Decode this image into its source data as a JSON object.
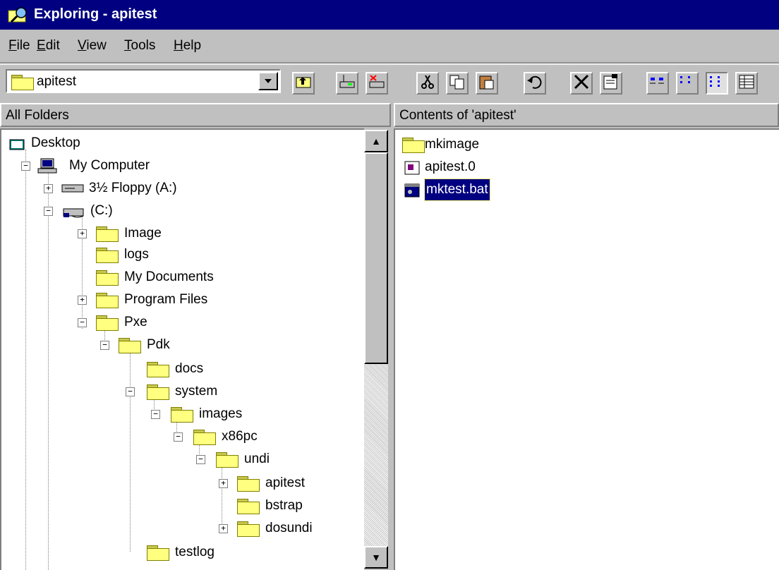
{
  "window": {
    "title": "Exploring - apitest"
  },
  "menu": [
    {
      "label": "File",
      "accel": "F",
      "rest": "ile"
    },
    {
      "label": "Edit",
      "accel": "E",
      "rest": "dit"
    },
    {
      "label": "View",
      "accel": "V",
      "rest": "iew"
    },
    {
      "label": "Tools",
      "accel": "T",
      "rest": "ools"
    },
    {
      "label": "Help",
      "accel": "H",
      "rest": "elp"
    }
  ],
  "toolbar": {
    "address_value": "apitest"
  },
  "left_header": "All Folders",
  "right_header": "Contents of 'apitest'",
  "tree": [
    {
      "label": "Desktop",
      "icon": "desktop-icon"
    },
    {
      "label": "My Computer",
      "icon": "computer-icon"
    },
    {
      "label": "3½ Floppy (A:)",
      "icon": "floppy-icon"
    },
    {
      "label": "(C:)",
      "icon": "drive-icon"
    },
    {
      "label": "Image",
      "icon": "shared-folder-icon"
    },
    {
      "label": "logs",
      "icon": "folder-icon"
    },
    {
      "label": "My Documents",
      "icon": "folder-icon"
    },
    {
      "label": "Program Files",
      "icon": "folder-icon"
    },
    {
      "label": "Pxe",
      "icon": "folder-icon"
    },
    {
      "label": "Pdk",
      "icon": "folder-icon"
    },
    {
      "label": "docs",
      "icon": "folder-icon"
    },
    {
      "label": "system",
      "icon": "folder-icon"
    },
    {
      "label": "images",
      "icon": "folder-icon"
    },
    {
      "label": "x86pc",
      "icon": "folder-icon"
    },
    {
      "label": "undi",
      "icon": "folder-icon"
    },
    {
      "label": "apitest",
      "icon": "open-folder-icon"
    },
    {
      "label": "bstrap",
      "icon": "folder-icon"
    },
    {
      "label": "dosundi",
      "icon": "folder-icon"
    },
    {
      "label": "testlog",
      "icon": "shared-folder-icon"
    }
  ],
  "files": [
    {
      "label": "mkimage",
      "icon": "folder-icon"
    },
    {
      "label": "apitest.0",
      "icon": "file-icon"
    },
    {
      "label": "mktest.bat",
      "icon": "batch-file-icon",
      "selected": true
    }
  ]
}
